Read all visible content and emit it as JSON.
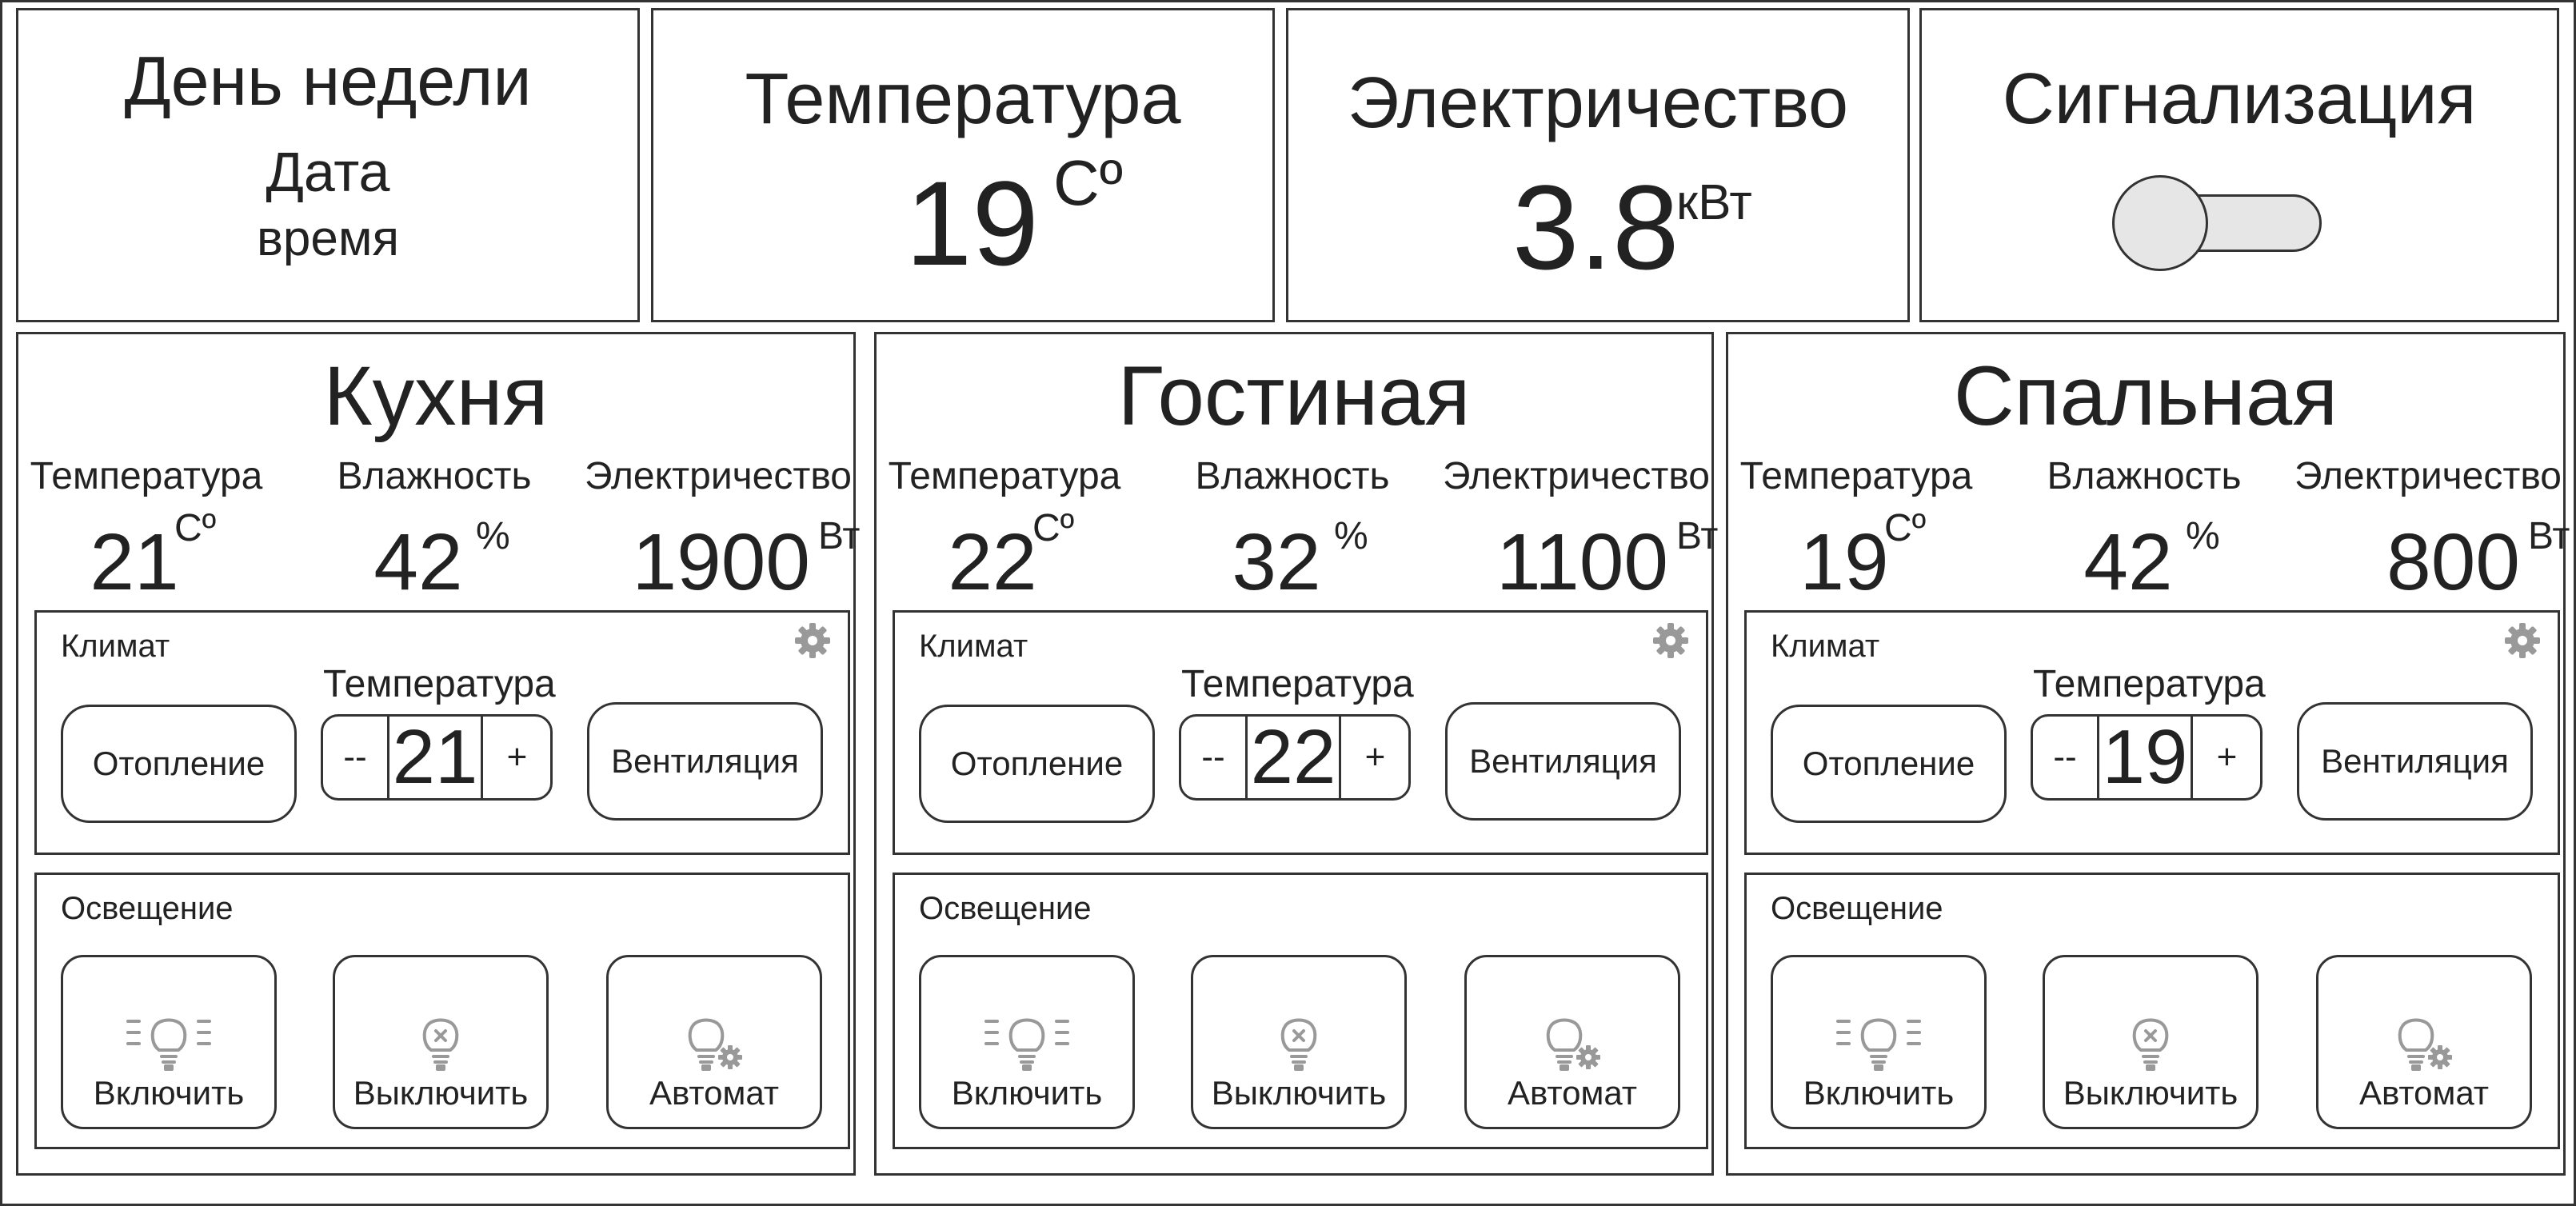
{
  "header": {
    "datetime": {
      "day": "День недели",
      "date": "Дата",
      "time": "время"
    },
    "temperature": {
      "title": "Температура",
      "value": "19",
      "unit": "Сº"
    },
    "electricity": {
      "title": "Электричество",
      "value": "3.8",
      "unit": "кВт"
    },
    "alarm": {
      "title": "Сигнализация",
      "enabled": false
    }
  },
  "labels": {
    "temperature": "Температура",
    "humidity": "Влажность",
    "electricity": "Электричество",
    "climate": "Климат",
    "lighting": "Освещение",
    "heating": "Отопление",
    "ventilation": "Вентиляция",
    "minus": "--",
    "plus": "+",
    "light_on": "Включить",
    "light_off": "Выключить",
    "light_auto": "Автомат",
    "unit_temp": "Сº",
    "unit_humidity": "%",
    "unit_power": "Вт"
  },
  "rooms": [
    {
      "name": "Кухня",
      "temperature": "21",
      "humidity": "42",
      "power": "1900",
      "setpoint": "21"
    },
    {
      "name": "Гостиная",
      "temperature": "22",
      "humidity": "32",
      "power": "1100",
      "setpoint": "22"
    },
    {
      "name": "Спальная",
      "temperature": "19",
      "humidity": "42",
      "power": "800",
      "setpoint": "19"
    }
  ],
  "icons": {
    "gear": "gear-icon",
    "light_on": "lightbulb-on-icon",
    "light_off": "lightbulb-off-icon",
    "light_auto": "lightbulb-auto-icon"
  },
  "colors": {
    "border": "#333333",
    "icon": "#999999",
    "toggle_fill": "#e6e6e6"
  }
}
